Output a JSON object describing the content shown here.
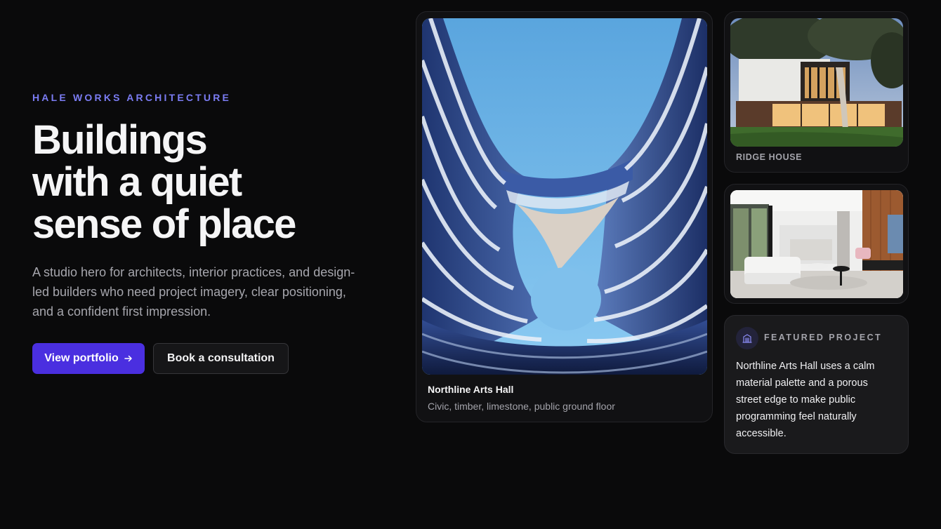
{
  "hero": {
    "eyebrow": "HALE WORKS ARCHITECTURE",
    "headline_lines": [
      "Buildings",
      "with a quiet",
      "sense of place"
    ],
    "lede": "A studio hero for architects, interior practices, and design-led builders who need project imagery, clear positioning, and a confident first impression.",
    "primary_button": "View portfolio",
    "primary_icon": "arrow-right-icon",
    "secondary_button": "Book a consultation"
  },
  "main_card": {
    "title": "Northline Arts Hall",
    "subtitle": "Civic, timber, limestone, public ground floor"
  },
  "ridge_card": {
    "label": "RIDGE HOUSE"
  },
  "feature_card": {
    "icon": "building-icon",
    "eyebrow": "FEATURED PROJECT",
    "body": "Northline Arts Hall uses a calm material palette and a porous street edge to make public programming feel naturally accessible."
  },
  "colors": {
    "background": "#0a0a0b",
    "accent": "#4a2fe0",
    "eyebrow": "#7b7cf3"
  }
}
